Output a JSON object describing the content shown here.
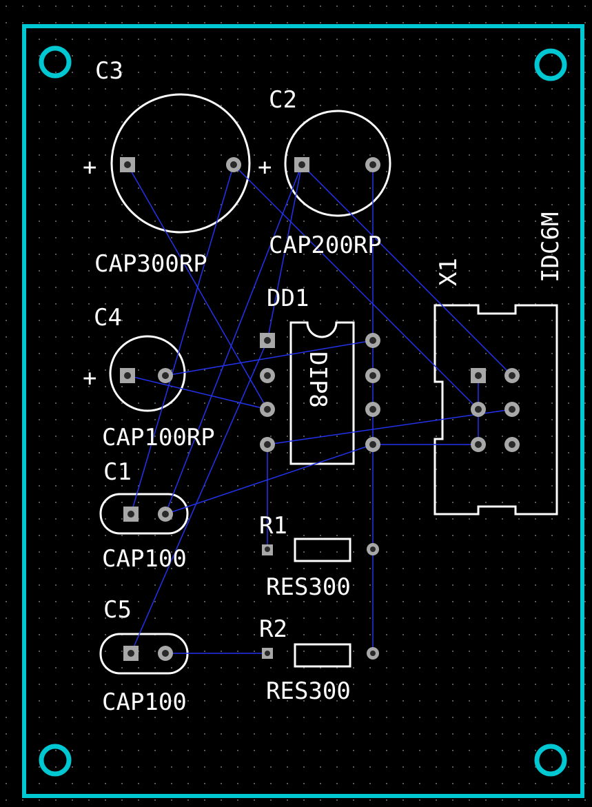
{
  "colors": {
    "background": "#000000",
    "outline": "#00c8d2",
    "silkscreen": "#ffffff",
    "pad": "#a8a8a8",
    "pad_hole": "#2a2a2a",
    "ratsnest": "#2233ee",
    "grid_dot": "#5a5a5a"
  },
  "components": {
    "c3": {
      "designator": "C3",
      "footprint": "CAP300RP",
      "plus": "+"
    },
    "c2": {
      "designator": "C2",
      "footprint": "CAP200RP",
      "plus": "+"
    },
    "c4": {
      "designator": "C4",
      "footprint": "CAP100RP",
      "plus": "+"
    },
    "c1": {
      "designator": "C1",
      "footprint": "CAP100"
    },
    "c5": {
      "designator": "C5",
      "footprint": "CAP100"
    },
    "dd1": {
      "designator": "DD1",
      "footprint": "DIP8"
    },
    "r1": {
      "designator": "R1",
      "footprint": "RES300"
    },
    "r2": {
      "designator": "R2",
      "footprint": "RES300"
    },
    "x1": {
      "designator": "X1",
      "footprint": "IDC6M"
    }
  },
  "icons": {
    "mounting_hole": "mounting-hole-icon",
    "square_pad": "square-pad-icon",
    "round_pad": "round-pad-icon"
  }
}
